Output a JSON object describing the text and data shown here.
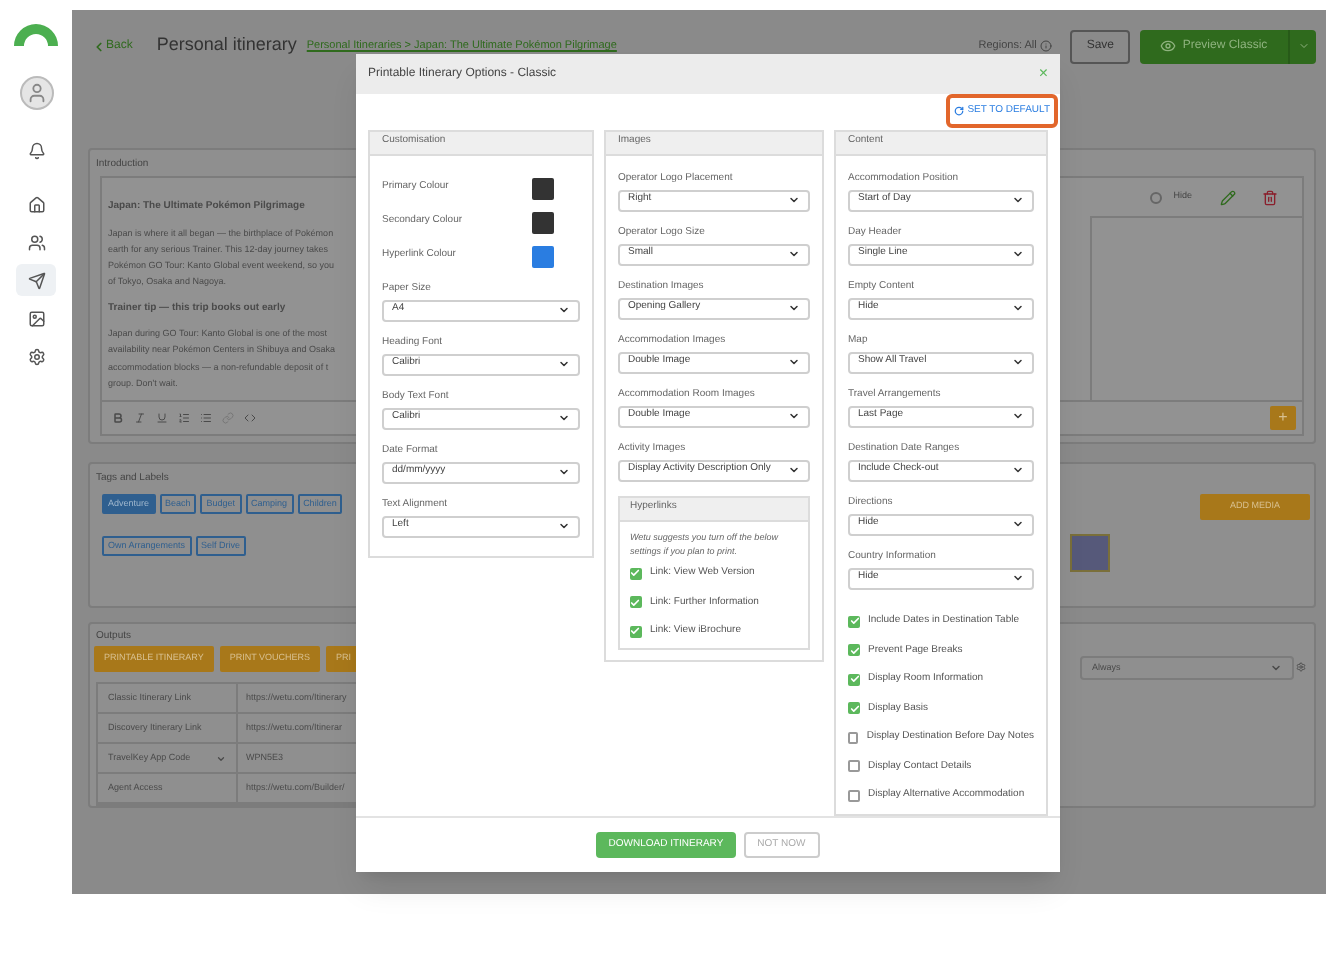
{
  "sidebar": {
    "items": [
      {
        "selected": false
      },
      {
        "selected": false
      },
      {
        "selected": false
      },
      {
        "selected": true
      },
      {
        "selected": false
      },
      {
        "selected": false
      }
    ]
  },
  "header": {
    "back": "Back",
    "title": "Personal itinerary",
    "breadcrumb": "Personal Itineraries > Japan: The Ultimate Pokémon Pilgrimage",
    "regions": "Regions: All",
    "save": "Save",
    "preview": "Preview Classic"
  },
  "introduction": {
    "title": "Introduction",
    "heading": "Japan: The Ultimate Pokémon Pilgrimage",
    "paragraph_1": [
      "Japan is where it all began — the birthplace of Pokémon",
      "earth for any serious Trainer. This 12-day journey takes",
      "Pokémon GO Tour: Kanto Global event weekend, so you",
      "of Tokyo, Osaka and Nagoya."
    ],
    "subheading": "Trainer tip — this trip books out early",
    "paragraph_2": [
      "Japan during GO Tour: Kanto Global is one of the most",
      "availability near Pokémon Centers in Shibuya and Osaka",
      "accommodation blocks — a non-refundable deposit of t",
      "group. Don't wait."
    ],
    "hide": {
      "label": "Hide",
      "checked": false
    },
    "add": "+"
  },
  "tags": {
    "title": "Tags and Labels",
    "items": [
      {
        "label": "Adventure",
        "selected": true
      },
      {
        "label": "Beach",
        "selected": false
      },
      {
        "label": "Budget",
        "selected": false
      },
      {
        "label": "Camping",
        "selected": false
      },
      {
        "label": "Children",
        "selected": false
      },
      {
        "label": "Own Arrangements",
        "selected": false
      },
      {
        "label": "Self Drive",
        "selected": false
      }
    ],
    "add_media": "ADD MEDIA"
  },
  "outputs": {
    "title": "Outputs",
    "buttons": [
      "PRINTABLE ITINERARY",
      "PRINT VOUCHERS",
      "PRI"
    ],
    "links": [
      {
        "kind": "text",
        "label": "Classic Itinerary Link",
        "value": "https://wetu.com/Itinerary"
      },
      {
        "kind": "text",
        "label": "Discovery Itinerary Link",
        "value": "https://wetu.com/Itinerar"
      },
      {
        "kind": "select",
        "label": "TravelKey App Code",
        "value": "WPN5E3"
      },
      {
        "kind": "text",
        "label": "Agent Access",
        "value": "https://wetu.com/Builder/"
      }
    ],
    "visibility": "Always"
  },
  "modal": {
    "title": "Printable Itinerary Options - Classic",
    "close": "×",
    "set_default": "SET TO DEFAULT",
    "customisation": {
      "title": "Customisation",
      "colours": [
        {
          "label": "Primary Colour",
          "color": "#333333"
        },
        {
          "label": "Secondary Colour",
          "color": "#333333"
        },
        {
          "label": "Hyperlink Colour",
          "color": "#2a7de1"
        }
      ],
      "selects": [
        {
          "label": "Paper Size",
          "value": "A4"
        },
        {
          "label": "Heading Font",
          "value": "Calibri"
        },
        {
          "label": "Body Text Font",
          "value": "Calibri"
        },
        {
          "label": "Date Format",
          "value": "dd/mm/yyyy"
        },
        {
          "label": "Text Alignment",
          "value": "Left"
        }
      ]
    },
    "images": {
      "title": "Images",
      "selects": [
        {
          "label": "Operator Logo Placement",
          "value": "Right"
        },
        {
          "label": "Operator Logo Size",
          "value": "Small"
        },
        {
          "label": "Destination Images",
          "value": "Opening Gallery"
        },
        {
          "label": "Accommodation Images",
          "value": "Double Image"
        },
        {
          "label": "Accommodation Room Images",
          "value": "Double Image"
        },
        {
          "label": "Activity Images",
          "value": "Display Activity Description Only"
        }
      ],
      "hyperlinks": {
        "title": "Hyperlinks",
        "note": "Wetu suggests you turn off the below settings if you plan to print.",
        "options": [
          {
            "label": "Link: View Web Version",
            "checked": true
          },
          {
            "label": "Link: Further Information",
            "checked": true
          },
          {
            "label": "Link: View iBrochure",
            "checked": true
          }
        ]
      }
    },
    "content": {
      "title": "Content",
      "selects": [
        {
          "label": "Accommodation Position",
          "value": "Start of Day"
        },
        {
          "label": "Day Header",
          "value": "Single Line"
        },
        {
          "label": "Empty Content",
          "value": "Hide"
        },
        {
          "label": "Map",
          "value": "Show All Travel"
        },
        {
          "label": "Travel Arrangements",
          "value": "Last Page"
        },
        {
          "label": "Destination Date Ranges",
          "value": "Include Check-out"
        },
        {
          "label": "Directions",
          "value": "Hide"
        },
        {
          "label": "Country Information",
          "value": "Hide"
        }
      ],
      "options": [
        {
          "label": "Include Dates in Destination Table",
          "checked": true
        },
        {
          "label": "Prevent Page Breaks",
          "checked": true
        },
        {
          "label": "Display Room Information",
          "checked": true
        },
        {
          "label": "Display Basis",
          "checked": true
        },
        {
          "label": "Display Destination Before Day Notes",
          "checked": false
        },
        {
          "label": "Display Contact Details",
          "checked": false
        },
        {
          "label": "Display Alternative Accommodation",
          "checked": false
        }
      ]
    },
    "download": "DOWNLOAD ITINERARY",
    "not_now": "NOT NOW"
  }
}
